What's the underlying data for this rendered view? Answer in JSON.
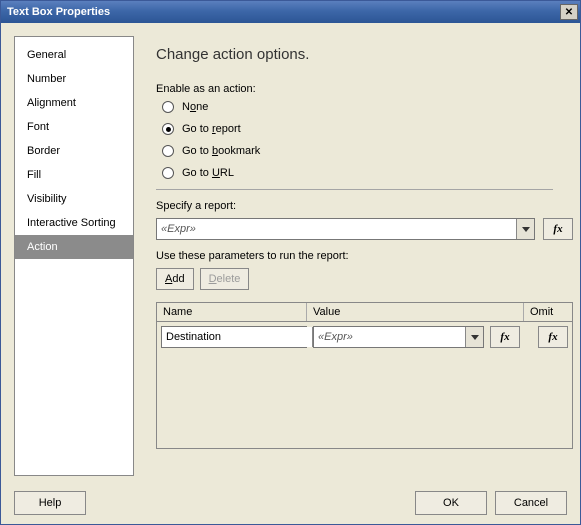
{
  "window": {
    "title": "Text Box Properties"
  },
  "sidebar": {
    "items": [
      {
        "label": "General"
      },
      {
        "label": "Number"
      },
      {
        "label": "Alignment"
      },
      {
        "label": "Font"
      },
      {
        "label": "Border"
      },
      {
        "label": "Fill"
      },
      {
        "label": "Visibility"
      },
      {
        "label": "Interactive Sorting"
      },
      {
        "label": "Action"
      }
    ],
    "selected": 8
  },
  "main": {
    "heading": "Change action options.",
    "enable_label": "Enable as an action:",
    "radios": {
      "none_pre": "N",
      "none_ul": "o",
      "none_post": "ne",
      "report_pre": "Go to ",
      "report_ul": "r",
      "report_post": "eport",
      "bookmark_pre": "Go to ",
      "bookmark_ul": "b",
      "bookmark_post": "ookmark",
      "url_pre": "Go to ",
      "url_ul": "U",
      "url_post": "RL",
      "selected": "report"
    },
    "report_section": {
      "label": "Specify a report:",
      "value": "«Expr»",
      "fx": "fx"
    },
    "params_section": {
      "label": "Use these parameters to run the report:",
      "add_ul": "A",
      "add_post": "dd",
      "delete_ul": "D",
      "delete_post": "elete",
      "headers": {
        "name": "Name",
        "value": "Value",
        "omit": "Omit"
      },
      "row": {
        "name": "Destination",
        "value": "«Expr»",
        "fx": "fx"
      }
    }
  },
  "footer": {
    "help": "Help",
    "ok": "OK",
    "cancel": "Cancel"
  }
}
